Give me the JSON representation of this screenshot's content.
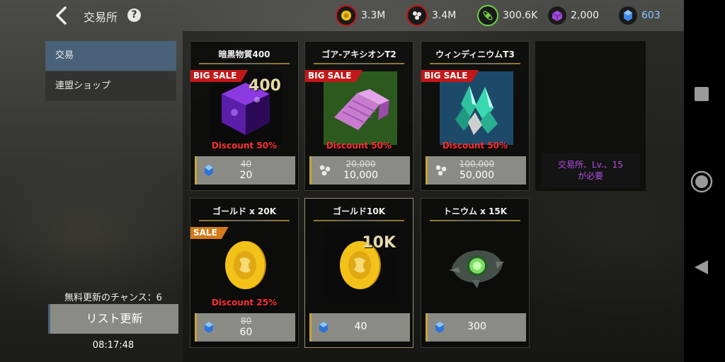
{
  "header": {
    "title": "交易所",
    "help": "?",
    "resources": [
      {
        "name": "gold-coin-resource",
        "icon": "coin-icon",
        "value": "3.3M",
        "color": "#f2c21a"
      },
      {
        "name": "platinum-resource",
        "icon": "molecule-icon",
        "value": "3.4M",
        "color": "#e8e8e8"
      },
      {
        "name": "energy-resource",
        "icon": "atom-icon",
        "value": "300.6K",
        "color": "#6ed040"
      },
      {
        "name": "dark-matter-resource",
        "icon": "cube-icon",
        "value": "2,000",
        "color": "#a04ad8"
      },
      {
        "name": "crystal-resource",
        "icon": "crystal-icon",
        "value": "603",
        "color": "#5aa8f0"
      }
    ]
  },
  "sidebar": {
    "tabs": [
      "交易",
      "連盟ショップ"
    ],
    "refresh_count_label": "無料更新のチャンス：6",
    "refresh_button": "リスト更新",
    "timer": "08:17:48"
  },
  "shop": {
    "items": [
      {
        "name": "暗黒物質400",
        "badge": "BIG SALE",
        "qty": "400",
        "discount": "Discount 50%",
        "old_price": "40",
        "price": "20",
        "currency": "crystal-icon",
        "image": "dark-cube-icon"
      },
      {
        "name": "ゴア-アキシオンT2",
        "badge": "BIG SALE",
        "qty": "",
        "discount": "Discount 50%",
        "old_price": "20,000",
        "price": "10,000",
        "currency": "molecule-icon",
        "image": "alloy-plate-icon"
      },
      {
        "name": "ウィンディニウムT3",
        "badge": "BIG SALE",
        "qty": "",
        "discount": "Discount 50%",
        "old_price": "100,000",
        "price": "50,000",
        "currency": "molecule-icon",
        "image": "crystal-cluster-icon"
      },
      {
        "name": "ゴールド x 20K",
        "badge": "SALE",
        "qty": "",
        "discount": "Discount 25%",
        "old_price": "80",
        "price": "60",
        "currency": "crystal-icon",
        "image": "gold-coin-icon"
      },
      {
        "name": "ゴールド10K",
        "badge": "",
        "qty": "10K",
        "discount": "",
        "old_price": "",
        "price": "40",
        "currency": "crystal-icon",
        "image": "gold-coin-icon"
      },
      {
        "name": "トニウム x 15K",
        "badge": "",
        "qty": "",
        "discount": "",
        "old_price": "",
        "price": "300",
        "currency": "crystal-icon",
        "image": "tonium-device-icon"
      }
    ],
    "locked_message": "交易所、Lv.、15が必要"
  },
  "navbar": {
    "buttons": [
      "square-icon",
      "circle-icon",
      "triangle-back-icon"
    ]
  }
}
